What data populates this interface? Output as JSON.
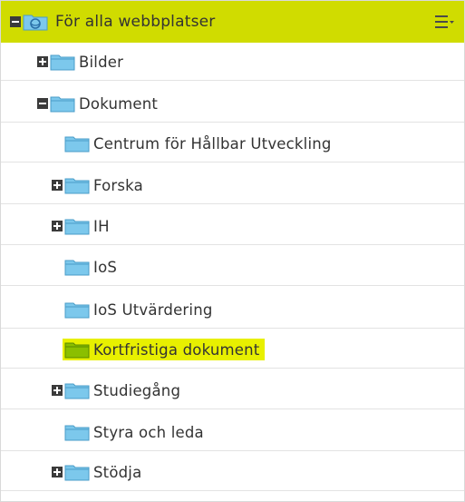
{
  "colors": {
    "header_bg": "#d0dc00",
    "folder": "#7cc8ec",
    "highlight": "#e8f000",
    "folder_highlighted": "#8bbf00"
  },
  "header": {
    "title": "För alla webbplatser",
    "menu_icon": "hamburger-dropdown-icon",
    "toggle": "minus"
  },
  "tree": [
    {
      "label": "Bilder",
      "toggle": "plus"
    },
    {
      "label": "Dokument",
      "toggle": "minus"
    },
    {
      "label": "Centrum för Hållbar Utveckling",
      "toggle": "none"
    },
    {
      "label": "Forska",
      "toggle": "plus"
    },
    {
      "label": "IH",
      "toggle": "plus"
    },
    {
      "label": "IoS",
      "toggle": "none"
    },
    {
      "label": "IoS Utvärdering",
      "toggle": "none"
    },
    {
      "label": "Kortfristiga dokument",
      "toggle": "none",
      "highlighted": true
    },
    {
      "label": "Studiegång",
      "toggle": "plus"
    },
    {
      "label": "Styra och leda",
      "toggle": "none"
    },
    {
      "label": "Stödja",
      "toggle": "plus"
    }
  ]
}
